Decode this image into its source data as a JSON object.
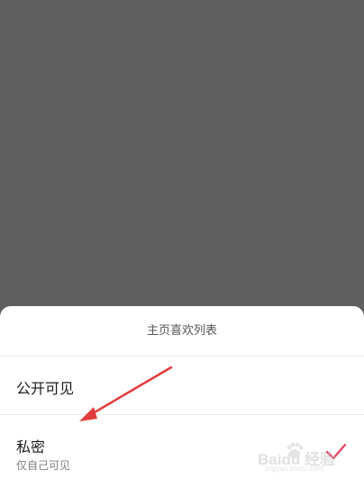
{
  "sheet": {
    "title": "主页喜欢列表",
    "options": [
      {
        "label": "公开可见",
        "sublabel": "",
        "selected": false
      },
      {
        "label": "私密",
        "sublabel": "仅自己可见",
        "selected": true
      }
    ]
  },
  "icons": {
    "check": "check-icon",
    "annotation": "red-arrow-annotation"
  },
  "colors": {
    "backdrop": "#5f5f5f",
    "sheet_background": "#ffffff",
    "check": "#e0405a",
    "annotation_arrow": "#e23b3b"
  },
  "watermark": {
    "text": "Baidu 经验",
    "subtext": "jingyan.baidu.com"
  }
}
